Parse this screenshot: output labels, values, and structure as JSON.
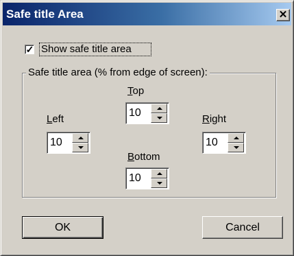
{
  "window": {
    "title": "Safe title Area",
    "close_glyph": "✕"
  },
  "show_checkbox": {
    "label": "Show safe title area",
    "checked": true,
    "mark": "✓"
  },
  "group": {
    "label": "Safe title area (% from edge of screen):"
  },
  "fields": {
    "top": {
      "label_mnemonic": "T",
      "label_rest": "op",
      "value": "10"
    },
    "left": {
      "label_mnemonic": "L",
      "label_rest": "eft",
      "value": "10"
    },
    "right": {
      "label_mnemonic": "R",
      "label_rest": "ight",
      "value": "10"
    },
    "bottom": {
      "label_mnemonic": "B",
      "label_rest": "ottom",
      "value": "10"
    }
  },
  "buttons": {
    "ok": "OK",
    "cancel": "Cancel"
  },
  "colors": {
    "dialog_face": "#d4d0c8",
    "titlebar_start": "#0a246a",
    "titlebar_end": "#a6caf0"
  }
}
